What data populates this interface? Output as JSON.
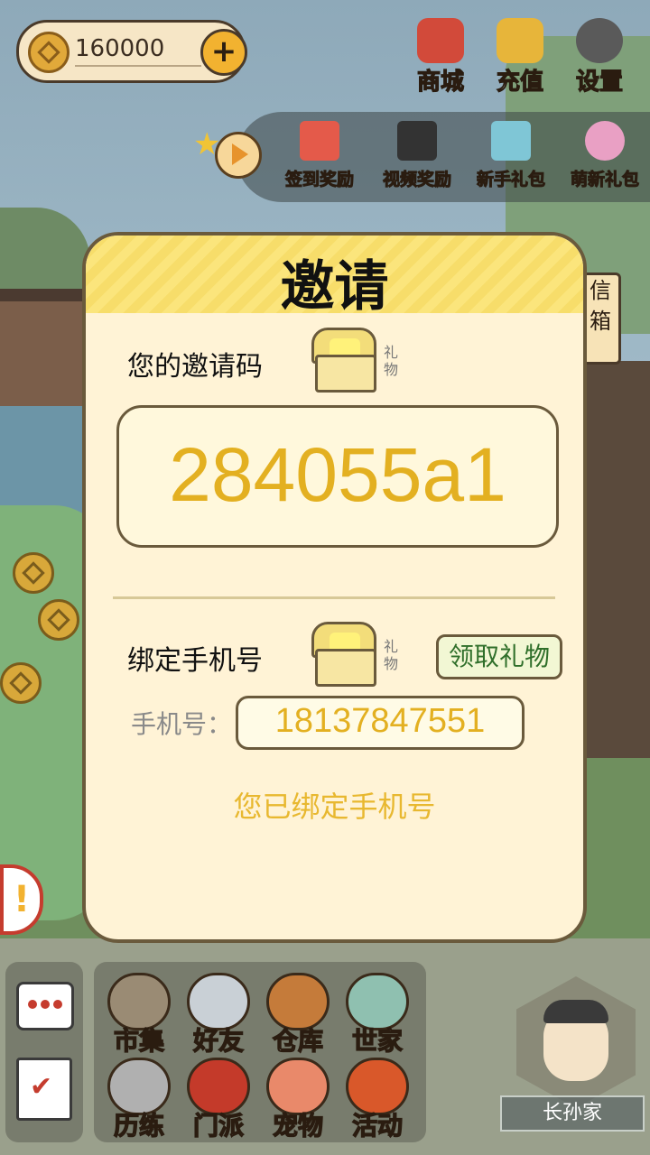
{
  "currency": {
    "amount": "160000",
    "icon": "coin-icon",
    "add_icon": "plus-icon"
  },
  "top_menu": [
    {
      "label": "商城",
      "icon": "shop-bag-icon",
      "color": "#d24a3a"
    },
    {
      "label": "充值",
      "icon": "gold-ingot-icon",
      "color": "#e7b53a"
    },
    {
      "label": "设置",
      "icon": "gear-icon",
      "color": "#5a5a5a"
    }
  ],
  "reward_row": [
    {
      "label": "签到奖励",
      "icon": "calendar-icon",
      "color": "#e45a4a"
    },
    {
      "label": "视频奖励",
      "icon": "clapperboard-icon",
      "color": "#333333"
    },
    {
      "label": "新手礼包",
      "icon": "gift-chest-icon",
      "color": "#7fc6d6"
    },
    {
      "label": "萌新礼包",
      "icon": "gift-character-icon",
      "color": "#e9a0c4"
    }
  ],
  "dialog": {
    "title": "邀请",
    "invite_label": "您的邀请码",
    "gift_label": "礼物",
    "invite_code": "284055a1",
    "bind_label": "绑定手机号",
    "claim_button": "领取礼物",
    "phone_label": "手机号：",
    "phone_value": "18137847551",
    "bound_message": "您已绑定手机号"
  },
  "bottom_menu": [
    {
      "label": "市集",
      "icon": "market-icon",
      "color": "#9a8b74"
    },
    {
      "label": "好友",
      "icon": "handshake-icon",
      "color": "#c9d0d6"
    },
    {
      "label": "仓库",
      "icon": "treasure-chest-icon",
      "color": "#c57b3a"
    },
    {
      "label": "世家",
      "icon": "cauldron-icon",
      "color": "#8fc0b0"
    },
    {
      "label": "历练",
      "icon": "crossed-swords-icon",
      "color": "#b0b0b0"
    },
    {
      "label": "门派",
      "icon": "banner-icon",
      "color": "#c43a2a"
    },
    {
      "label": "宠物",
      "icon": "paw-icon",
      "color": "#e9896a"
    },
    {
      "label": "活动",
      "icon": "lantern-icon",
      "color": "#d9582a"
    }
  ],
  "side": {
    "mail_label": "信箱",
    "alert_symbol": "!"
  },
  "player": {
    "name": "长孙家"
  }
}
